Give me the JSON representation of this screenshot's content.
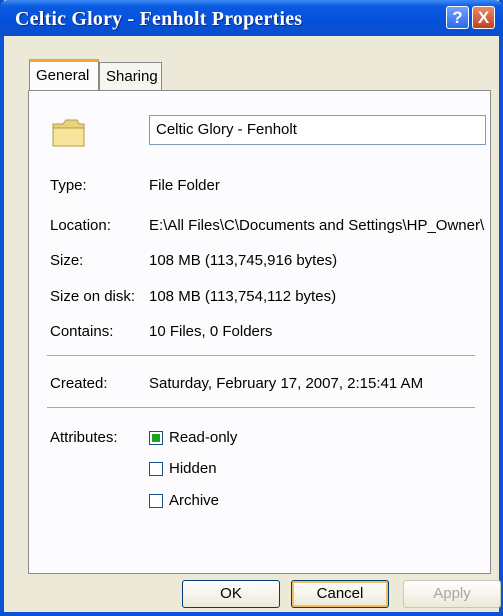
{
  "window": {
    "title": "Celtic Glory - Fenholt Properties",
    "help_glyph": "?",
    "close_glyph": "X"
  },
  "tabs": [
    {
      "label": "General",
      "active": true
    },
    {
      "label": "Sharing",
      "active": false
    }
  ],
  "general": {
    "icon": "folder-icon",
    "name": "Celtic Glory - Fenholt",
    "type": {
      "label": "Type:",
      "value": "File Folder"
    },
    "location": {
      "label": "Location:",
      "value": "E:\\All Files\\C\\Documents and Settings\\HP_Owner\\"
    },
    "size": {
      "label": "Size:",
      "value": "108 MB (113,745,916 bytes)"
    },
    "size_on_disk": {
      "label": "Size on disk:",
      "value": "108 MB (113,754,112 bytes)"
    },
    "contains": {
      "label": "Contains:",
      "value": "10 Files, 0 Folders"
    },
    "created": {
      "label": "Created:",
      "value": "Saturday, February 17, 2007, 2:15:41 AM"
    },
    "attributes": {
      "label": "Attributes:",
      "items": [
        {
          "label": "Read-only",
          "checked": true
        },
        {
          "label": "Hidden",
          "checked": false
        },
        {
          "label": "Archive",
          "checked": false
        }
      ]
    }
  },
  "buttons": {
    "ok": "OK",
    "cancel": "Cancel",
    "apply": "Apply"
  },
  "colors": {
    "titlebar": "#0550dc",
    "dialog_bg": "#ece9d8",
    "tab_accent": "#f6a334"
  }
}
